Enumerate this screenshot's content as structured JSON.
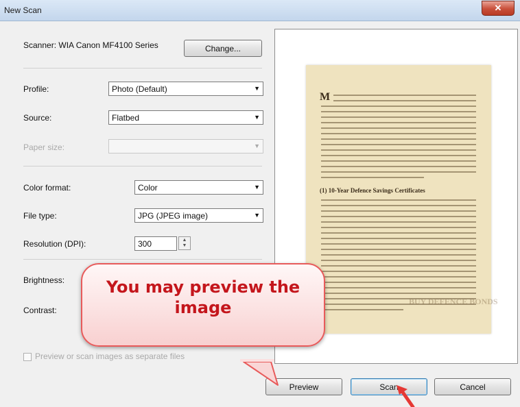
{
  "window": {
    "title": "New Scan",
    "close_glyph": "✕"
  },
  "scanner": {
    "label": "Scanner: WIA Canon MF4100 Series",
    "change_label": "Change..."
  },
  "profile": {
    "label": "Profile:",
    "value": "Photo (Default)"
  },
  "source": {
    "label": "Source:",
    "value": "Flatbed"
  },
  "paper_size": {
    "label": "Paper size:",
    "value": ""
  },
  "color_format": {
    "label": "Color format:",
    "value": "Color"
  },
  "file_type": {
    "label": "File type:",
    "value": "JPG (JPEG image)"
  },
  "resolution": {
    "label": "Resolution (DPI):",
    "value": "300"
  },
  "brightness": {
    "label": "Brightness:"
  },
  "contrast": {
    "label": "Contrast:"
  },
  "separate_files": {
    "label": "Preview or scan images as separate files",
    "checked": false
  },
  "buttons": {
    "preview": "Preview",
    "scan": "Scan",
    "cancel": "Cancel"
  },
  "callout": {
    "line1": "You may preview the",
    "line2": "image"
  },
  "preview_doc": {
    "initial": "M",
    "heading": "(1) 10-Year Defence Savings Certificates",
    "stamp": "BUY DEFENCE BONDS"
  },
  "colors": {
    "callout_text": "#c4161c",
    "callout_border": "#e85a5a",
    "paper": "#efe3bf"
  }
}
